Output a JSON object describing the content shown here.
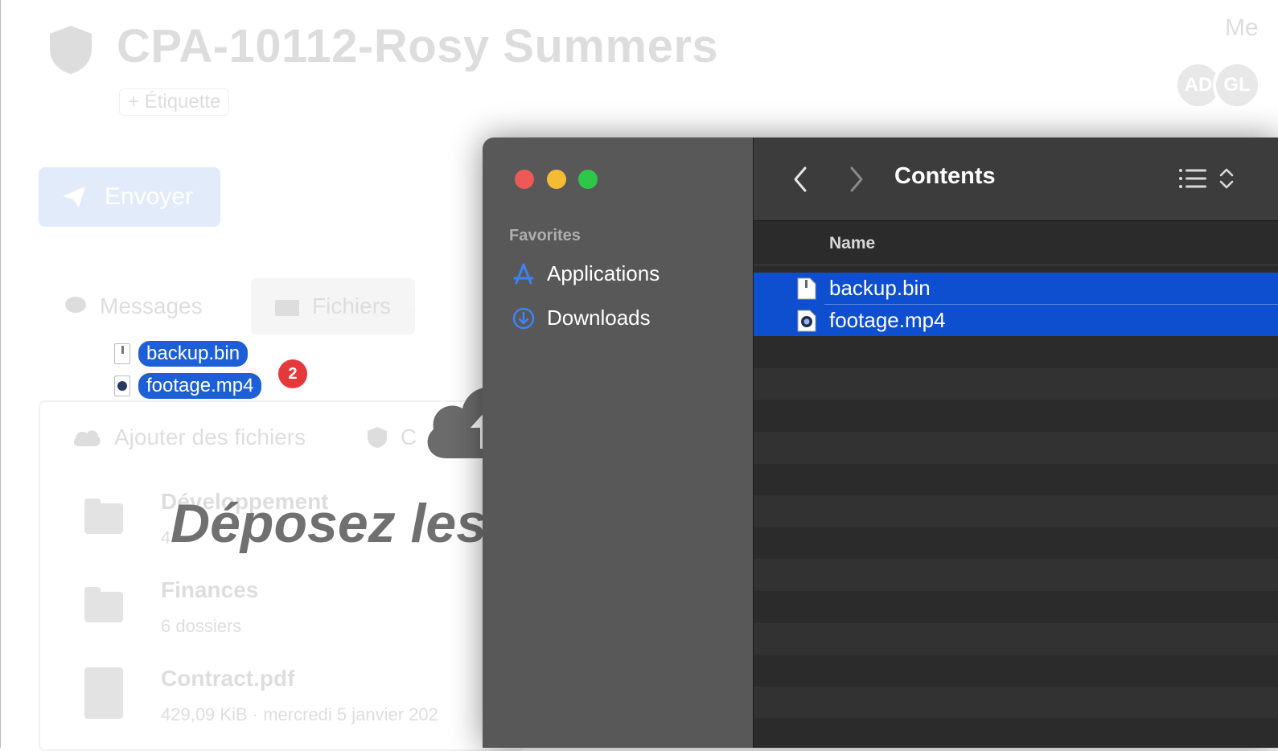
{
  "background_app": {
    "title": "CPA-10112-Rosy Summers",
    "tag_label": "+ Étiquette",
    "members_label": "Me",
    "avatars": [
      "AD",
      "GL"
    ],
    "send_label": "Envoyer",
    "tabs": [
      {
        "label": "Messages",
        "active": false
      },
      {
        "label": "Fichiers",
        "active": true
      }
    ],
    "actions": {
      "add_files": "Ajouter des fichiers",
      "second": "C"
    },
    "rows": [
      {
        "title": "Développement",
        "subtitle": "4"
      },
      {
        "title": "Finances",
        "subtitle": "6 dossiers"
      },
      {
        "title": "Contract.pdf",
        "subtitle": "429,09 KiB · mercredi 5 janvier 202"
      }
    ]
  },
  "drop_overlay": {
    "text": "Déposez les"
  },
  "drag": {
    "items": [
      "backup.bin",
      "footage.mp4"
    ],
    "count": "2"
  },
  "finder": {
    "title": "Contents",
    "sidebar": {
      "heading": "Favorites",
      "items": [
        {
          "label": "Applications",
          "icon": "applications-icon"
        },
        {
          "label": "Downloads",
          "icon": "downloads-icon"
        }
      ]
    },
    "column_name": "Name",
    "files": [
      {
        "name": "backup.bin",
        "icon": "document-icon",
        "selected": true
      },
      {
        "name": "footage.mp4",
        "icon": "video-file-icon",
        "selected": true
      }
    ],
    "colors": {
      "selection": "#0d4fcf",
      "close": "#ed5a55",
      "minimize": "#f5bb35",
      "zoom": "#2fc748"
    }
  }
}
